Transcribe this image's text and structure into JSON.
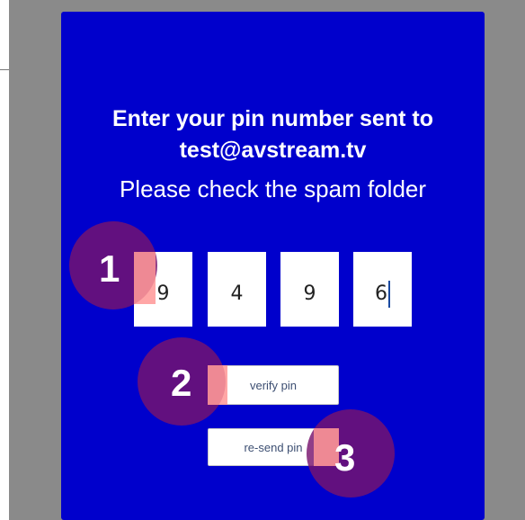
{
  "colors": {
    "modal_background": "#0000cc",
    "backdrop": "#8a8a8a",
    "marker": "#78146e",
    "highlight": "#ff9696"
  },
  "dialog": {
    "title_line1": "Enter your pin number sent to",
    "title_line2": "test@avstream.tv",
    "subtitle": "Please check the spam folder",
    "pin_digits": [
      "9",
      "4",
      "9",
      "6"
    ],
    "verify_button_label": "verify pin",
    "resend_button_label": "re-send pin"
  },
  "annotations": {
    "markers": [
      "1",
      "2",
      "3"
    ]
  }
}
